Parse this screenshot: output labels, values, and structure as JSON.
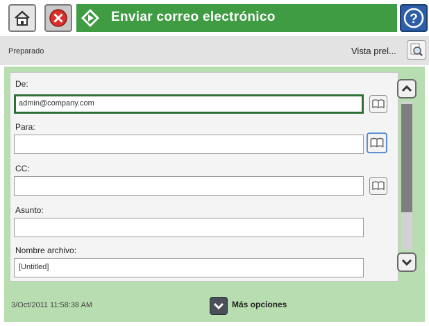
{
  "header": {
    "title": "Enviar correo electrónico",
    "icons": [
      "home-icon",
      "cancel-icon",
      "start-icon",
      "help-icon"
    ],
    "accent_color": "#3f9c43"
  },
  "status": {
    "text": "Preparado",
    "preview_label": "Vista prel..."
  },
  "form": {
    "from": {
      "label": "De:",
      "value": "admin@company.com"
    },
    "to": {
      "label": "Para:",
      "value": ""
    },
    "cc": {
      "label": "CC:",
      "value": ""
    },
    "subject": {
      "label": "Asunto:",
      "value": ""
    },
    "filename": {
      "label": "Nombre archivo:",
      "value": "[Untitled]"
    }
  },
  "footer": {
    "timestamp": "3/Oct/2011 11:58:38 AM",
    "more_options": "Más opciones"
  }
}
